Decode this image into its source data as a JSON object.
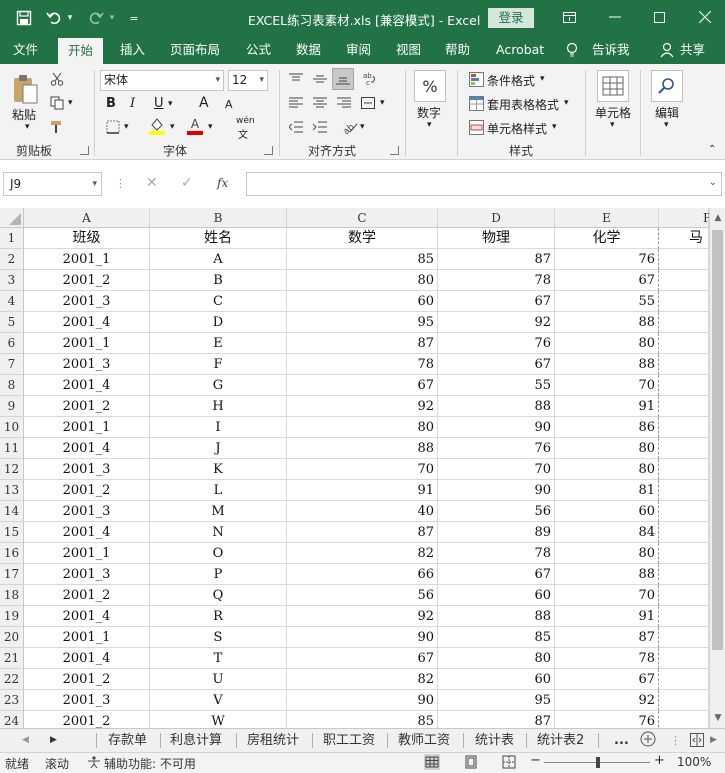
{
  "window": {
    "title": "EXCEL练习表素材.xls  [兼容模式] - Excel",
    "login_label": "登录",
    "accent": "#217346"
  },
  "quick_access": [
    "save-icon",
    "undo-icon",
    "redo-icon",
    "customize-icon"
  ],
  "menu_tabs": [
    {
      "label": "文件"
    },
    {
      "label": "开始"
    },
    {
      "label": "插入"
    },
    {
      "label": "页面布局"
    },
    {
      "label": "公式"
    },
    {
      "label": "数据"
    },
    {
      "label": "审阅"
    },
    {
      "label": "视图"
    },
    {
      "label": "帮助"
    },
    {
      "label": "Acrobat"
    },
    {
      "label": "告诉我"
    },
    {
      "label": "共享"
    }
  ],
  "ribbon": {
    "clipboard": {
      "label": "剪贴板",
      "paste": "粘贴"
    },
    "font": {
      "label": "字体",
      "family": "宋体",
      "size": "12",
      "bold": "B",
      "italic": "I",
      "underline": "U",
      "wen": "wén",
      "grow": "A",
      "shrink": "A",
      "font_color_mark": "A"
    },
    "alignment": {
      "label": "对齐方式"
    },
    "number": {
      "label": "数字",
      "symbol": "%"
    },
    "styles": {
      "label": "样式",
      "conditional": "条件格式",
      "table": "套用表格格式",
      "cell": "单元格样式"
    },
    "cells": {
      "label": "单元格"
    },
    "editing": {
      "label": "编辑"
    }
  },
  "formula_bar": {
    "name_box": "J9",
    "fx": "fx",
    "content": ""
  },
  "columns": [
    "A",
    "B",
    "C",
    "D",
    "E",
    "F"
  ],
  "header_row": {
    "row": "1",
    "a": "班级",
    "b": "姓名",
    "c": "数学",
    "d": "物理",
    "e": "化学",
    "f": "马"
  },
  "rows": [
    {
      "row": "2",
      "a": "2001_1",
      "b": "A",
      "c": "85",
      "d": "87",
      "e": "76"
    },
    {
      "row": "3",
      "a": "2001_2",
      "b": "B",
      "c": "80",
      "d": "78",
      "e": "67"
    },
    {
      "row": "4",
      "a": "2001_3",
      "b": "C",
      "c": "60",
      "d": "67",
      "e": "55"
    },
    {
      "row": "5",
      "a": "2001_4",
      "b": "D",
      "c": "95",
      "d": "92",
      "e": "88"
    },
    {
      "row": "6",
      "a": "2001_1",
      "b": "E",
      "c": "87",
      "d": "76",
      "e": "80"
    },
    {
      "row": "7",
      "a": "2001_3",
      "b": "F",
      "c": "78",
      "d": "67",
      "e": "88"
    },
    {
      "row": "8",
      "a": "2001_4",
      "b": "G",
      "c": "67",
      "d": "55",
      "e": "70"
    },
    {
      "row": "9",
      "a": "2001_2",
      "b": "H",
      "c": "92",
      "d": "88",
      "e": "91"
    },
    {
      "row": "10",
      "a": "2001_1",
      "b": "I",
      "c": "80",
      "d": "90",
      "e": "86"
    },
    {
      "row": "11",
      "a": "2001_4",
      "b": "J",
      "c": "88",
      "d": "76",
      "e": "80"
    },
    {
      "row": "12",
      "a": "2001_3",
      "b": "K",
      "c": "70",
      "d": "70",
      "e": "80"
    },
    {
      "row": "13",
      "a": "2001_2",
      "b": "L",
      "c": "91",
      "d": "90",
      "e": "81"
    },
    {
      "row": "14",
      "a": "2001_3",
      "b": "M",
      "c": "40",
      "d": "56",
      "e": "60"
    },
    {
      "row": "15",
      "a": "2001_4",
      "b": "N",
      "c": "87",
      "d": "89",
      "e": "84"
    },
    {
      "row": "16",
      "a": "2001_1",
      "b": "O",
      "c": "82",
      "d": "78",
      "e": "80"
    },
    {
      "row": "17",
      "a": "2001_3",
      "b": "P",
      "c": "66",
      "d": "67",
      "e": "88"
    },
    {
      "row": "18",
      "a": "2001_2",
      "b": "Q",
      "c": "56",
      "d": "60",
      "e": "70"
    },
    {
      "row": "19",
      "a": "2001_4",
      "b": "R",
      "c": "92",
      "d": "88",
      "e": "91"
    },
    {
      "row": "20",
      "a": "2001_1",
      "b": "S",
      "c": "90",
      "d": "85",
      "e": "87"
    },
    {
      "row": "21",
      "a": "2001_4",
      "b": "T",
      "c": "67",
      "d": "80",
      "e": "78"
    },
    {
      "row": "22",
      "a": "2001_2",
      "b": "U",
      "c": "82",
      "d": "60",
      "e": "67"
    },
    {
      "row": "23",
      "a": "2001_3",
      "b": "V",
      "c": "90",
      "d": "95",
      "e": "92"
    },
    {
      "row": "24",
      "a": "2001_2",
      "b": "W",
      "c": "85",
      "d": "87",
      "e": "76"
    }
  ],
  "sheets": [
    {
      "label": "存款单"
    },
    {
      "label": "利息计算"
    },
    {
      "label": "房租统计"
    },
    {
      "label": "职工工资"
    },
    {
      "label": "教师工资"
    },
    {
      "label": "统计表"
    },
    {
      "label": "统计表2"
    }
  ],
  "sheet_more": "...",
  "status": {
    "ready": "就绪",
    "scroll": "滚动",
    "accessibility": "辅助功能: 不可用",
    "zoom": "100%"
  }
}
